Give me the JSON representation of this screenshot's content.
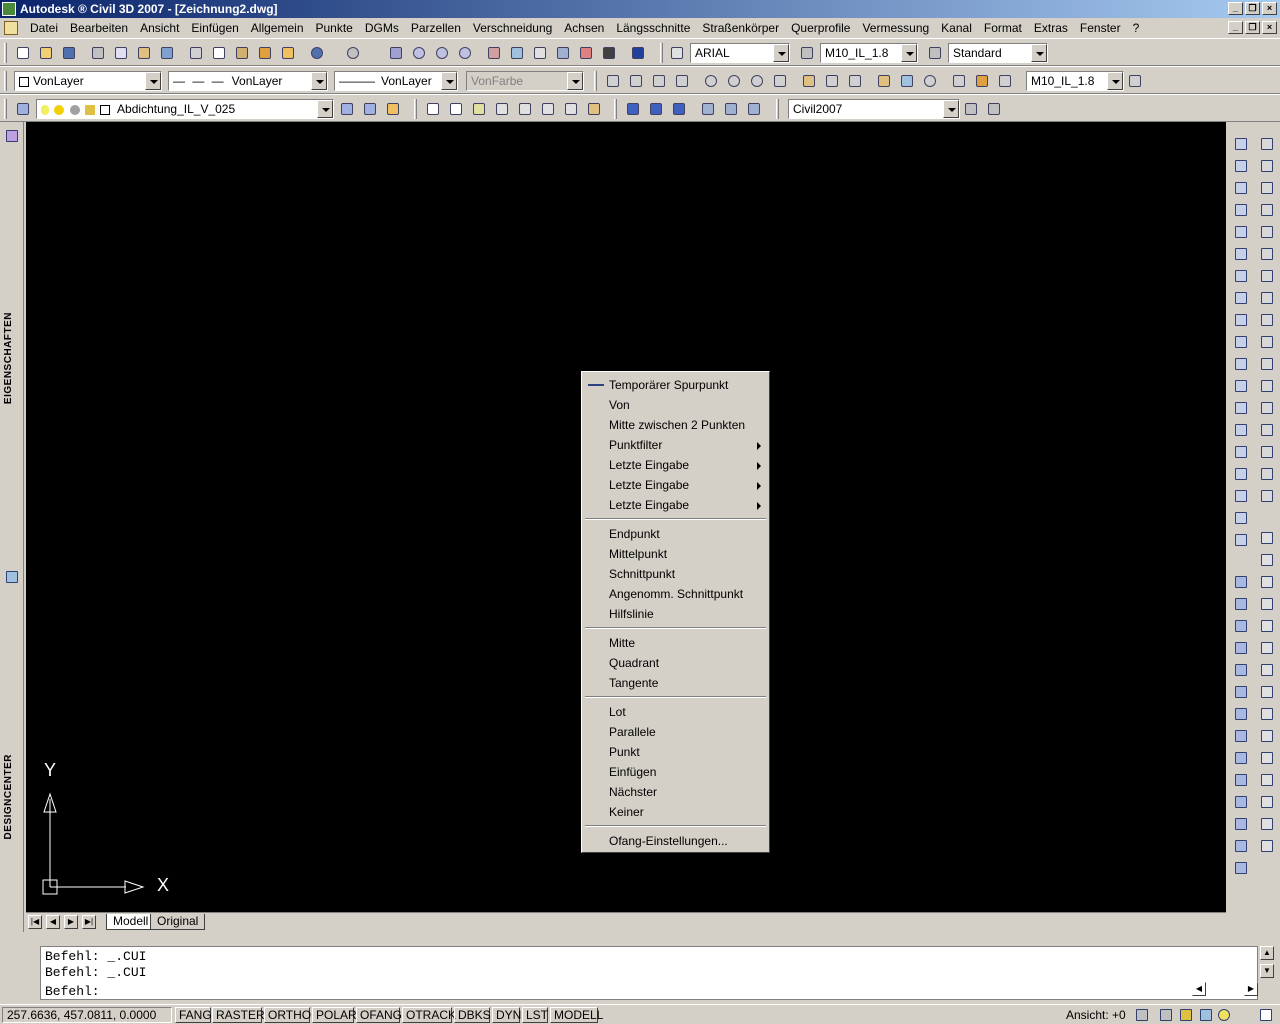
{
  "window": {
    "title": "Autodesk ® Civil 3D 2007 - [Zeichnung2.dwg]"
  },
  "menu": {
    "items": [
      "Datei",
      "Bearbeiten",
      "Ansicht",
      "Einfügen",
      "Allgemein",
      "Punkte",
      "DGMs",
      "Parzellen",
      "Verschneidung",
      "Achsen",
      "Längsschnitte",
      "Straßenkörper",
      "Querprofile",
      "Vermessung",
      "Kanal",
      "Format",
      "Extras",
      "Fenster",
      "?"
    ]
  },
  "toolbar1": {
    "font": "ARIAL",
    "textstyle": "M10_IL_1.8",
    "dimstyle": "Standard"
  },
  "toolbar2": {
    "layer_combo": "VonLayer",
    "linetype": "VonLayer",
    "lineweight": "VonLayer",
    "color": "VonFarbe",
    "textstyle2": "M10_IL_1.8"
  },
  "toolbar3": {
    "layer": "Abdichtung_IL_V_025",
    "style": "Civil2007"
  },
  "panels": {
    "left_top": "EIGENSCHAFTEN",
    "left_bottom": "DESIGNCENTER"
  },
  "ucs": {
    "y_label": "Y",
    "x_label": "X"
  },
  "tabs": {
    "model": "Modell",
    "layout": "Original"
  },
  "context_menu": {
    "items": [
      {
        "label": "Temporärer Spurpunkt"
      },
      {
        "label": "Von"
      },
      {
        "label": "Mitte zwischen 2 Punkten"
      },
      {
        "label": "Punktfilter",
        "submenu": true
      },
      {
        "label": "Letzte Eingabe",
        "submenu": true
      },
      {
        "label": "Letzte Eingabe",
        "submenu": true
      },
      {
        "label": "Letzte Eingabe",
        "submenu": true
      },
      {
        "label": "Endpunkt"
      },
      {
        "label": "Mittelpunkt"
      },
      {
        "label": "Schnittpunkt"
      },
      {
        "label": "Angenomm. Schnittpunkt"
      },
      {
        "label": "Hilfslinie"
      },
      {
        "label": "Mitte"
      },
      {
        "label": "Quadrant"
      },
      {
        "label": "Tangente"
      },
      {
        "label": "Lot"
      },
      {
        "label": "Parallele"
      },
      {
        "label": "Punkt"
      },
      {
        "label": "Einfügen"
      },
      {
        "label": "Nächster"
      },
      {
        "label": "Keiner"
      },
      {
        "label": "Ofang-Einstellungen..."
      }
    ]
  },
  "command": {
    "lines": [
      "Befehl: _.CUI",
      "Befehl: _.CUI",
      "Befehl:"
    ]
  },
  "status": {
    "coords": "257.6636, 457.0811, 0.0000",
    "buttons": [
      "FANG",
      "RASTER",
      "ORTHO",
      "POLAR",
      "OFANG",
      "OTRACK",
      "DBKS",
      "DYN",
      "LST",
      "MODELL"
    ],
    "view_label": "Ansicht: +0"
  },
  "colors": {
    "titlebar_start": "#0a246a",
    "titlebar_end": "#a6caf0",
    "canvas": "#000000",
    "ui": "#d4d0c8"
  }
}
